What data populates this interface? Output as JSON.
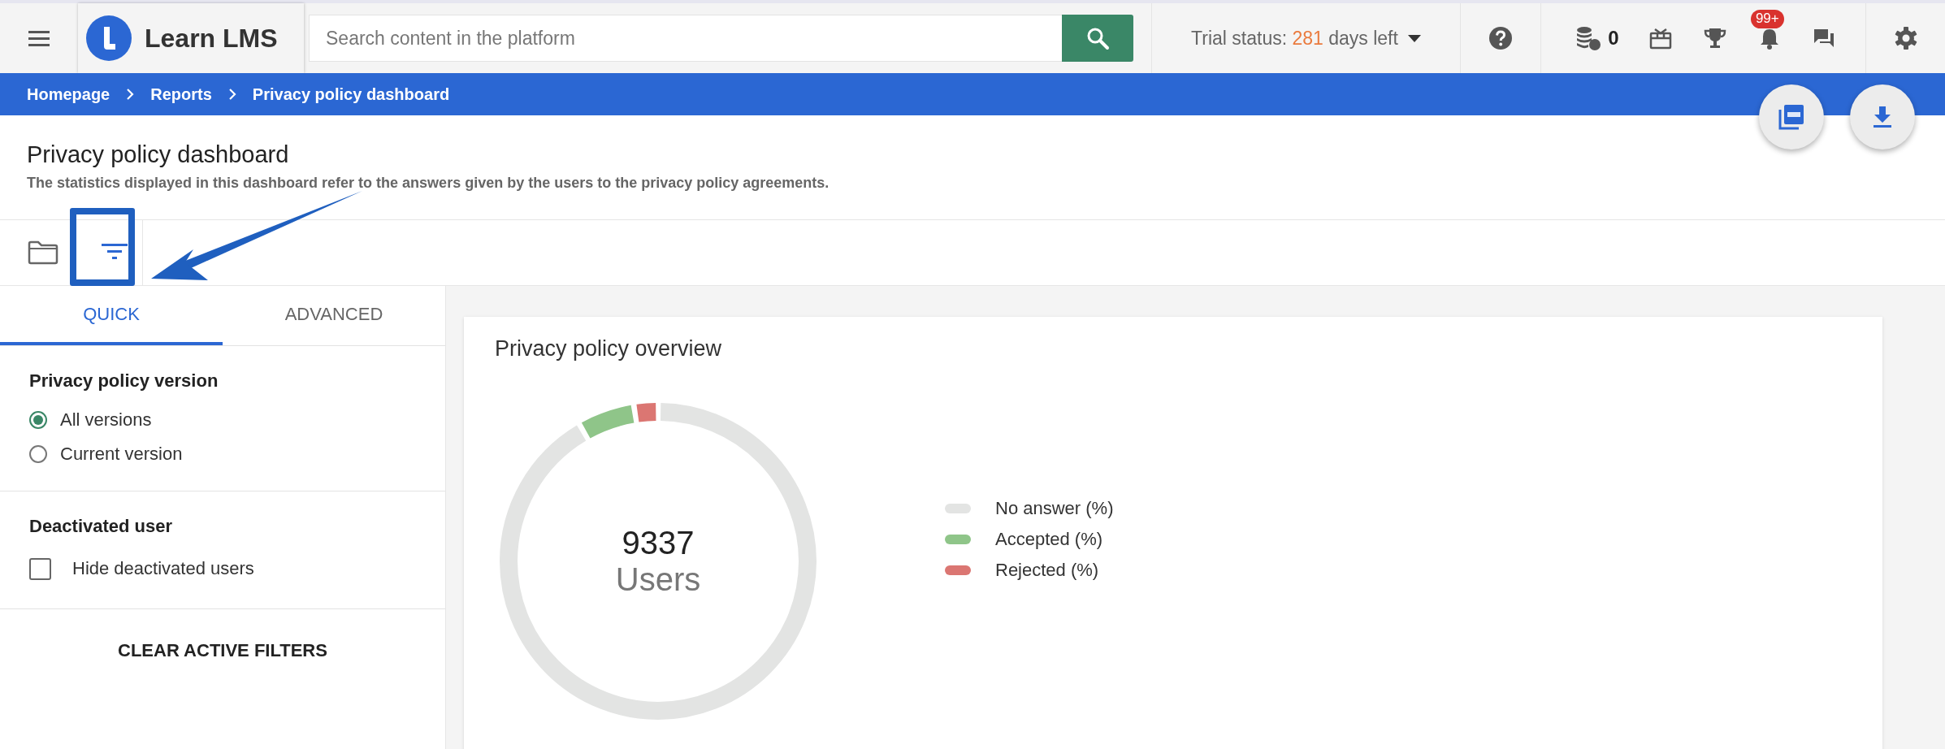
{
  "top_bar": {
    "app_name": "Learn LMS",
    "search": {
      "placeholder": "Search content in the platform"
    },
    "trial_status": {
      "label": "Trial status:",
      "days": "281",
      "suffix": "days left"
    },
    "coins": "0",
    "notifications_badge": "99+"
  },
  "breadcrumbs": [
    "Homepage",
    "Reports",
    "Privacy policy dashboard"
  ],
  "page": {
    "title": "Privacy policy dashboard",
    "description": "The statistics displayed in this dashboard refer to the answers given by the users to the privacy policy agreements."
  },
  "filter_tabs": [
    {
      "label": "QUICK",
      "selected": true
    },
    {
      "label": "ADVANCED",
      "selected": false
    }
  ],
  "filter_sections": [
    {
      "title": "Privacy policy version",
      "options": [
        {
          "kind": "radio",
          "label": "All versions",
          "selected": true
        },
        {
          "kind": "radio",
          "label": "Current version",
          "selected": false
        }
      ]
    },
    {
      "title": "Deactivated user",
      "options": [
        {
          "kind": "checkbox",
          "label": "Hide deactivated users",
          "checked": false
        }
      ]
    }
  ],
  "clear_button": "CLEAR ACTIVE FILTERS",
  "overview": {
    "title": "Privacy policy overview",
    "total": "9337",
    "total_label": "Users",
    "legend": [
      {
        "label": "No answer (%)",
        "color": "#e3e4e3"
      },
      {
        "label": "Accepted (%)",
        "color": "#8fc589"
      },
      {
        "label": "Rejected (%)",
        "color": "#db7672"
      }
    ]
  }
}
